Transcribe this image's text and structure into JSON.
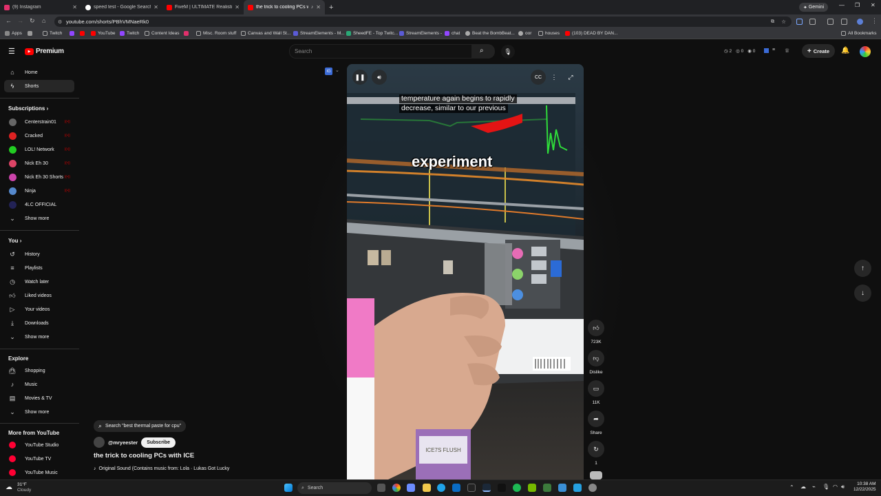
{
  "browser": {
    "tabs": [
      {
        "title": "(9) Instagram",
        "color": "#e1306c"
      },
      {
        "title": "speed test - Google Search",
        "color": "#4285f4"
      },
      {
        "title": "FiveM | ULTIMATE Realistic Gra...",
        "color": "#ff0000"
      },
      {
        "title": "the trick to cooling PCs with...",
        "color": "#ff0000"
      }
    ],
    "new_tab": "+",
    "gemini_label": "Gemini",
    "url": "youtube.com/shorts/PBhVMNaeRk0",
    "bookmarks": [
      {
        "label": "Apps",
        "color": "#888"
      },
      {
        "label": "Twitch",
        "color": "#9146ff"
      },
      {
        "label": "YouTube",
        "color": "#ff0000"
      },
      {
        "label": "Twitch",
        "color": "#9146ff"
      },
      {
        "label": "Content Ideas",
        "color": "#aaa"
      },
      {
        "label": "Misc. Room stuff",
        "color": "#aaa"
      },
      {
        "label": "Canvas and Wall St...",
        "color": "#aaa"
      },
      {
        "label": "StreamElements - M...",
        "color": "#5b5bd6"
      },
      {
        "label": "SheedFE - Top Twitc...",
        "color": "#2aa876"
      },
      {
        "label": "StreamElements -",
        "color": "#5b5bd6"
      },
      {
        "label": "chat",
        "color": "#9146ff"
      },
      {
        "label": "Beat the BombBeat...",
        "color": "#aaa"
      },
      {
        "label": "oor",
        "color": "#aaa"
      },
      {
        "label": "houses",
        "color": "#aaa"
      },
      {
        "label": "(103) DEAD BY DAN...",
        "color": "#ff0000"
      }
    ],
    "all_bookmarks": "All Bookmarks"
  },
  "yt": {
    "logo": "Premium",
    "search_placeholder": "Search",
    "create": "Create",
    "counters": [
      "2",
      "0",
      "0"
    ],
    "sidebar": {
      "main": [
        {
          "label": "Home",
          "icon": "home-icon"
        },
        {
          "label": "Shorts",
          "icon": "shorts-icon",
          "active": true
        }
      ],
      "subscriptions_title": "Subscriptions",
      "subscriptions": [
        {
          "label": "Centerstrain01",
          "color": "#666"
        },
        {
          "label": "Cracked",
          "color": "#d22"
        },
        {
          "label": "LOL! Network",
          "color": "#2c2"
        },
        {
          "label": "Nick Eh 30",
          "color": "#d46"
        },
        {
          "label": "Nick Eh 30 Shorts",
          "color": "#c4a"
        },
        {
          "label": "Ninja",
          "color": "#58c"
        },
        {
          "label": "4LC OFFICIAL",
          "color": "#225"
        }
      ],
      "show_more": "Show more",
      "you_title": "You",
      "you": [
        {
          "label": "History",
          "icon": "history-icon"
        },
        {
          "label": "Playlists",
          "icon": "playlists-icon"
        },
        {
          "label": "Watch later",
          "icon": "clock-icon"
        },
        {
          "label": "Liked videos",
          "icon": "thumbs-up-icon"
        },
        {
          "label": "Your videos",
          "icon": "play-icon"
        },
        {
          "label": "Downloads",
          "icon": "download-icon"
        }
      ],
      "explore_title": "Explore",
      "explore": [
        {
          "label": "Shopping",
          "icon": "bag-icon"
        },
        {
          "label": "Music",
          "icon": "music-icon"
        },
        {
          "label": "Movies & TV",
          "icon": "film-icon"
        }
      ],
      "more_title": "More from YouTube",
      "more": [
        {
          "label": "YouTube Studio"
        },
        {
          "label": "YouTube TV"
        },
        {
          "label": "YouTube Music"
        }
      ]
    },
    "short": {
      "caption_line1": "temperature again begins to rapidly",
      "caption_line2": "decrease, similar to our previous",
      "big_word": "experiment",
      "search_chip": "Search \"best thermal paste for cpu\"",
      "channel": "@mryeester",
      "subscribe": "Subscribe",
      "title": "the trick to cooling PCs with ICE",
      "sound": "Original Sound (Contains music from: Lola · Lukas Got Lucky",
      "bottle_text": "ICE7S FLUSH",
      "actions": [
        {
          "label": "723K",
          "icon": "like-icon"
        },
        {
          "label": "Dislike",
          "icon": "dislike-icon"
        },
        {
          "label": "11K",
          "icon": "comment-icon"
        },
        {
          "label": "Share",
          "icon": "share-icon"
        },
        {
          "label": "1",
          "icon": "remix-icon"
        }
      ]
    }
  },
  "taskbar": {
    "weather_temp": "31°F",
    "weather_desc": "Cloudy",
    "search": "Search",
    "time": "10:38 AM",
    "date": "12/22/2025"
  }
}
